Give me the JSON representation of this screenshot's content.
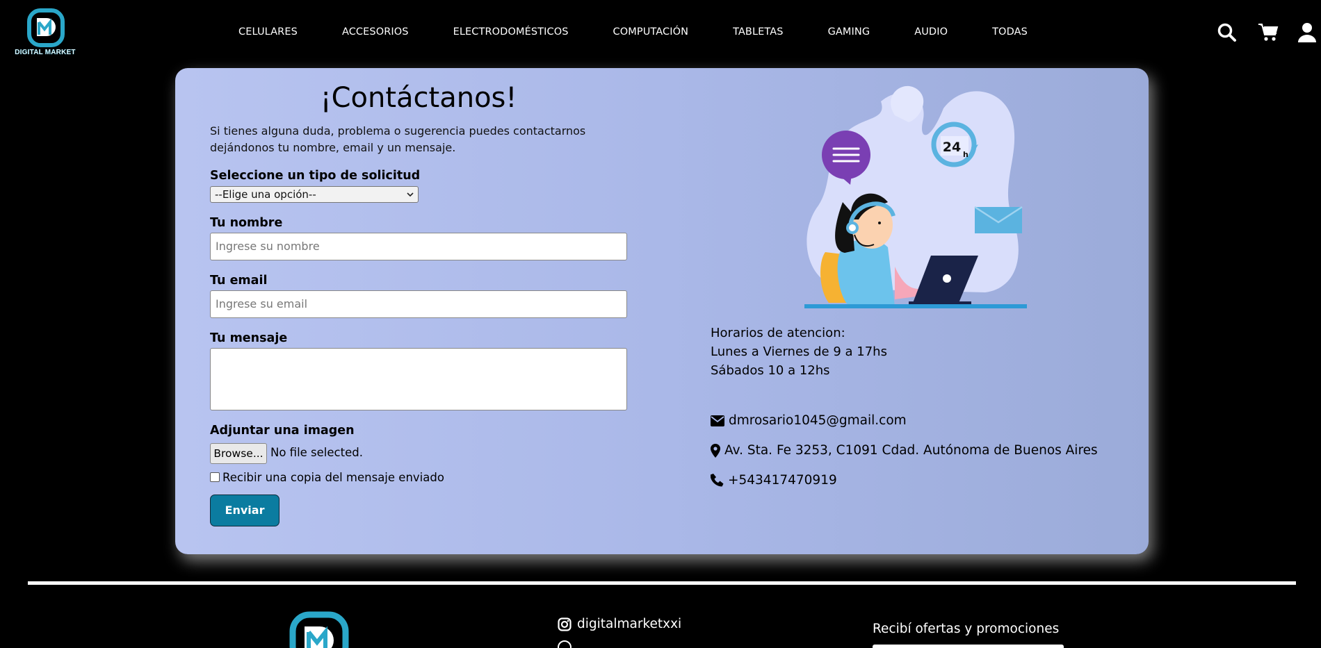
{
  "brand": {
    "name": "DIGITAL MARKET",
    "colors": {
      "primary": "#2aa7c9",
      "button": "#0b7ca0",
      "background": "#000000",
      "card": "#b0bdec"
    }
  },
  "nav": {
    "links": [
      "CELULARES",
      "ACCESORIOS",
      "ELECTRODOMÉSTICOS",
      "COMPUTACIÓN",
      "TABLETAS",
      "GAMING",
      "AUDIO",
      "TODAS"
    ],
    "icons": [
      "search-icon",
      "cart-icon",
      "user-icon"
    ]
  },
  "contact": {
    "title": "¡Contáctanos!",
    "intro": "Si tienes alguna duda, problema o sugerencia puedes contactarnos dejándonos tu nombre, email y un mensaje.",
    "request_type": {
      "label": "Seleccione un tipo de solicitud",
      "selected": "--Elige una opción--"
    },
    "name": {
      "label": "Tu nombre",
      "placeholder": "Ingrese su nombre"
    },
    "email": {
      "label": "Tu email",
      "placeholder": "Ingrese su email"
    },
    "message": {
      "label": "Tu mensaje",
      "value": ""
    },
    "attachment": {
      "label": "Adjuntar una imagen",
      "button": "Browse...",
      "status": "No file selected."
    },
    "copy_checkbox": {
      "label": "Recibir una copia del mensaje enviado",
      "checked": false
    },
    "submit": "Enviar"
  },
  "info": {
    "hours": [
      "Horarios de atencion:",
      "Lunes a Viernes de 9 a 17hs",
      "Sábados 10 a 12hs"
    ],
    "email": "dmrosario1045@gmail.com",
    "address": "Av. Sta. Fe 3253, C1091 Cdad. Autónoma de Buenos Aires",
    "phone": "+543417470919",
    "illustration_badge": "24"
  },
  "footer": {
    "instagram": "digitalmarketxxi",
    "promo_title": "Recibí ofertas y promociones"
  }
}
